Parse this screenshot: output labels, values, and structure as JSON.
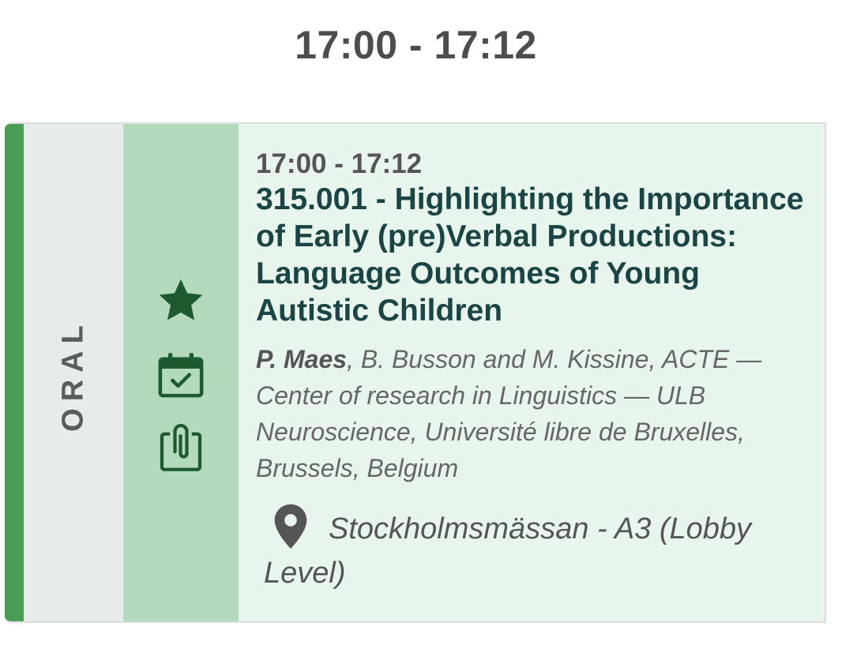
{
  "header": {
    "time_range": "17:00 - 17:12"
  },
  "session": {
    "type_label": "ORAL",
    "time": "17:00 - 17:12",
    "title": "315.001 - Highlighting the Importance of Early (pre)Verbal Productions: Language Outcomes of Young Autistic Children",
    "presenter": "P. Maes",
    "authors_rest": ", B. Busson and M. Kissine, ACTE — Center of research in Linguistics — ULB Neuroscience, Université libre de Bruxelles, Brussels, Belgium",
    "location": "Stockholmsmässan - A3 (Lobby Level)",
    "actions": {
      "favorite_icon": "star-icon",
      "calendar_icon": "calendar-check-icon",
      "materials_icon": "paperclip-clipboard-icon"
    }
  },
  "colors": {
    "accent_green": "#4a9d55",
    "card_background": "#e8f5ec",
    "actions_background": "#b3dabd",
    "type_background": "#e6ecec",
    "icon_green": "#1e5a30",
    "title_color": "#1b4545"
  }
}
